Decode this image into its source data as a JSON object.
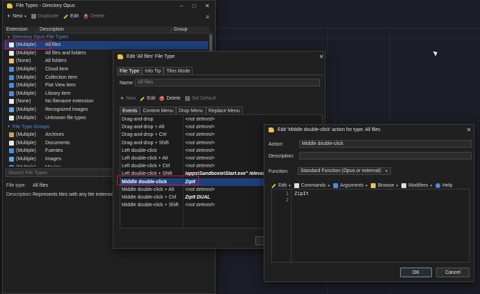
{
  "main_window": {
    "title": "File Types - Directory Opus",
    "toolbar": {
      "new": "New",
      "duplicate": "Duplicate",
      "edit": "Edit",
      "delete": "Delete"
    },
    "columns": [
      "Extension",
      "Description",
      "Group"
    ],
    "group1": "Directory Opus File Types",
    "rows1": [
      {
        "ext": "(Multiple)",
        "desc": "All files",
        "icon": "multi-file-icon"
      },
      {
        "ext": "(Multiple)",
        "desc": "All files and folders",
        "icon": "multi-file-icon"
      },
      {
        "ext": "(None)",
        "desc": "All folders",
        "icon": "folder-icon"
      },
      {
        "ext": "(Multiple)",
        "desc": "Cloud item",
        "icon": "cloud-icon"
      },
      {
        "ext": "(Multiple)",
        "desc": "Collection item",
        "icon": "collection-icon"
      },
      {
        "ext": "(Multiple)",
        "desc": "Flat View item",
        "icon": "flat-view-icon"
      },
      {
        "ext": "(Multiple)",
        "desc": "Library item",
        "icon": "library-icon"
      },
      {
        "ext": "(None)",
        "desc": "No filename extension",
        "icon": "document-icon"
      },
      {
        "ext": "(Multiple)",
        "desc": "Recognized images",
        "icon": "image-icon"
      },
      {
        "ext": "(Multiple)",
        "desc": "Unknown file types",
        "icon": "document-icon"
      }
    ],
    "group2": "File Type Groups",
    "rows2": [
      {
        "ext": "(Multiple)",
        "desc": "Archives",
        "icon": "archive-icon"
      },
      {
        "ext": "(Multiple)",
        "desc": "Documents",
        "icon": "document-icon"
      },
      {
        "ext": "(Multiple)",
        "desc": "Fuentes",
        "icon": "font-icon"
      },
      {
        "ext": "(Multiple)",
        "desc": "Images",
        "icon": "image-icon"
      },
      {
        "ext": "(Multiple)",
        "desc": "Movies",
        "icon": "movie-icon"
      }
    ],
    "search_placeholder": "Search File Types",
    "file_type_label": "File type:",
    "file_type_value": "All files",
    "description_label": "Description:",
    "description_value": "Represents files with any file extension"
  },
  "edit_window": {
    "title": "Edit 'All files' File Type",
    "tabs": [
      "File Type",
      "Info Tip",
      "Tiles Mode"
    ],
    "name_label": "Name:",
    "name_value": "All files",
    "toolbar": {
      "new": "New",
      "edit": "Edit",
      "delete": "Delete",
      "set_default": "Set Default"
    },
    "sub_tabs": [
      "Events",
      "Context Menu",
      "Drop Menu",
      "Replace Menu"
    ],
    "events": [
      {
        "event": "Drag-and-drop",
        "action": "<not defined>"
      },
      {
        "event": "Drag-and-drop + Alt",
        "action": "<not defined>"
      },
      {
        "event": "Drag-and-drop + Ctrl",
        "action": "<not defined>"
      },
      {
        "event": "Drag-and-drop + Shift",
        "action": "<not defined>"
      },
      {
        "event": "Left double-click",
        "action": "<not defined>"
      },
      {
        "event": "Left double-click + Alt",
        "action": "<not defined>"
      },
      {
        "event": "Left double-click + Ctrl",
        "action": "<not defined>"
      },
      {
        "event": "Left double-click + Shift",
        "action": "/apps\\Sandboxie\\Start.exe\" /elevate /"
      },
      {
        "event": "Middle double-click",
        "action": "ZipIt"
      },
      {
        "event": "Middle double-click + Alt",
        "action": "<not defined>"
      },
      {
        "event": "Middle double-click + Ctrl",
        "action": "ZipIt DUAL"
      },
      {
        "event": "Middle double-click + Shift",
        "action": "<not defined>"
      }
    ]
  },
  "action_window": {
    "title": "Edit 'Middle double-click' action for type: All files",
    "action_label": "Action:",
    "action_value": "Middle double-click",
    "description_label": "Description:",
    "description_value": "",
    "function_label": "Function:",
    "function_value": "Standard Function (Opus or external)",
    "toolbar": [
      "Edit",
      "Commands",
      "Arguments",
      "Browse",
      "Modifiers",
      "Help"
    ],
    "line_numbers": [
      "1",
      "2"
    ],
    "code_lines": [
      "ZipIt",
      ""
    ],
    "ok": "OK",
    "cancel": "Cancel"
  }
}
